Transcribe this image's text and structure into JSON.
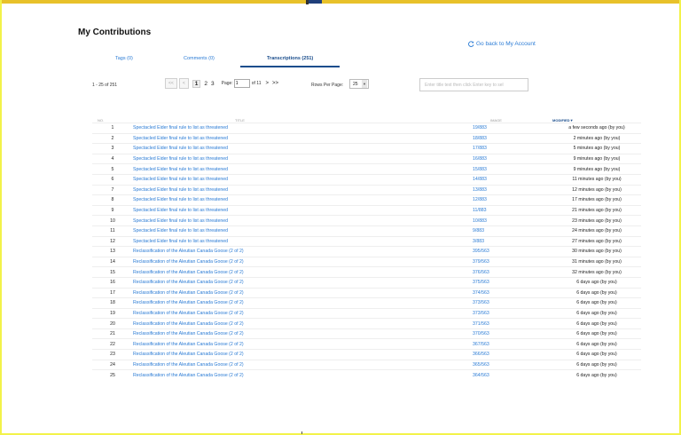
{
  "page": {
    "title": "My Contributions",
    "back_link": "Go back to My Account"
  },
  "tabs": [
    {
      "label": "Tags (0)",
      "active": false
    },
    {
      "label": "Comments (0)",
      "active": false
    },
    {
      "label": "Transcriptions (251)",
      "active": true
    }
  ],
  "pagination": {
    "range": "1 - 25 of 251",
    "first": "<<",
    "prev": "<",
    "pages": [
      "1",
      "2",
      "3"
    ],
    "current_page": "1",
    "page_label": "Page:",
    "page_input_value": "1",
    "of_label": "of 11",
    "next": ">",
    "last": ">>"
  },
  "rows_per_page": {
    "label": "Rows Per Page:",
    "value": "25"
  },
  "filter": {
    "placeholder": "Enter title text then click Enter key to sel"
  },
  "table": {
    "headers": {
      "no": "NO.",
      "title": "TITLE",
      "image": "IMAGE",
      "modified": "MODIFIED"
    },
    "sort_indicator": "▼",
    "rows": [
      {
        "no": "1",
        "title": "Spectacled Eider final rule to list as threatened",
        "image": "19/883",
        "modified": "a few seconds ago (by you)"
      },
      {
        "no": "2",
        "title": "Spectacled Eider final rule to list as threatened",
        "image": "18/883",
        "modified": "2 minutes ago (by you)"
      },
      {
        "no": "3",
        "title": "Spectacled Eider final rule to list as threatened",
        "image": "17/883",
        "modified": "5 minutes ago (by you)"
      },
      {
        "no": "4",
        "title": "Spectacled Eider final rule to list as threatened",
        "image": "16/883",
        "modified": "9 minutes ago (by you)"
      },
      {
        "no": "5",
        "title": "Spectacled Eider final rule to list as threatened",
        "image": "15/883",
        "modified": "9 minutes ago (by you)"
      },
      {
        "no": "6",
        "title": "Spectacled Eider final rule to list as threatened",
        "image": "14/883",
        "modified": "11 minutes ago (by you)"
      },
      {
        "no": "7",
        "title": "Spectacled Eider final rule to list as threatened",
        "image": "13/883",
        "modified": "12 minutes ago (by you)"
      },
      {
        "no": "8",
        "title": "Spectacled Eider final rule to list as threatened",
        "image": "12/883",
        "modified": "17 minutes ago (by you)"
      },
      {
        "no": "9",
        "title": "Spectacled Eider final rule to list as threatened",
        "image": "11/883",
        "modified": "21 minutes ago (by you)"
      },
      {
        "no": "10",
        "title": "Spectacled Eider final rule to list as threatened",
        "image": "10/883",
        "modified": "23 minutes ago (by you)"
      },
      {
        "no": "11",
        "title": "Spectacled Eider final rule to list as threatened",
        "image": "9/883",
        "modified": "24 minutes ago (by you)"
      },
      {
        "no": "12",
        "title": "Spectacled Eider final rule to list as threatened",
        "image": "3/883",
        "modified": "27 minutes ago (by you)"
      },
      {
        "no": "13",
        "title": "Reclassification of the Aleutian Canada Goose (2 of 2)",
        "image": "395/563",
        "modified": "30 minutes ago (by you)"
      },
      {
        "no": "14",
        "title": "Reclassification of the Aleutian Canada Goose (2 of 2)",
        "image": "379/563",
        "modified": "31 minutes ago (by you)"
      },
      {
        "no": "15",
        "title": "Reclassification of the Aleutian Canada Goose (2 of 2)",
        "image": "376/563",
        "modified": "32 minutes ago (by you)"
      },
      {
        "no": "16",
        "title": "Reclassification of the Aleutian Canada Goose (2 of 2)",
        "image": "375/563",
        "modified": "6 days ago (by you)"
      },
      {
        "no": "17",
        "title": "Reclassification of the Aleutian Canada Goose (2 of 2)",
        "image": "374/563",
        "modified": "6 days ago (by you)"
      },
      {
        "no": "18",
        "title": "Reclassification of the Aleutian Canada Goose (2 of 2)",
        "image": "373/563",
        "modified": "6 days ago (by you)"
      },
      {
        "no": "19",
        "title": "Reclassification of the Aleutian Canada Goose (2 of 2)",
        "image": "373/563",
        "modified": "6 days ago (by you)"
      },
      {
        "no": "20",
        "title": "Reclassification of the Aleutian Canada Goose (2 of 2)",
        "image": "371/563",
        "modified": "6 days ago (by you)"
      },
      {
        "no": "21",
        "title": "Reclassification of the Aleutian Canada Goose (2 of 2)",
        "image": "370/563",
        "modified": "6 days ago (by you)"
      },
      {
        "no": "22",
        "title": "Reclassification of the Aleutian Canada Goose (2 of 2)",
        "image": "367/563",
        "modified": "6 days ago (by you)"
      },
      {
        "no": "23",
        "title": "Reclassification of the Aleutian Canada Goose (2 of 2)",
        "image": "366/563",
        "modified": "6 days ago (by you)"
      },
      {
        "no": "24",
        "title": "Reclassification of the Aleutian Canada Goose (2 of 2)",
        "image": "365/563",
        "modified": "6 days ago (by you)"
      },
      {
        "no": "25",
        "title": "Reclassification of the Aleutian Canada Goose (2 of 2)",
        "image": "364/563",
        "modified": "6 days ago (by you)"
      }
    ]
  },
  "colors": {
    "link": "#2a7bd5",
    "active_tab": "#1a4d8c",
    "top_bar": "#1f3f7a",
    "top_bar_accent": "#e8c12a"
  },
  "icons": {
    "back": "refresh-arrow-icon",
    "select_caret": "caret-down-icon"
  }
}
